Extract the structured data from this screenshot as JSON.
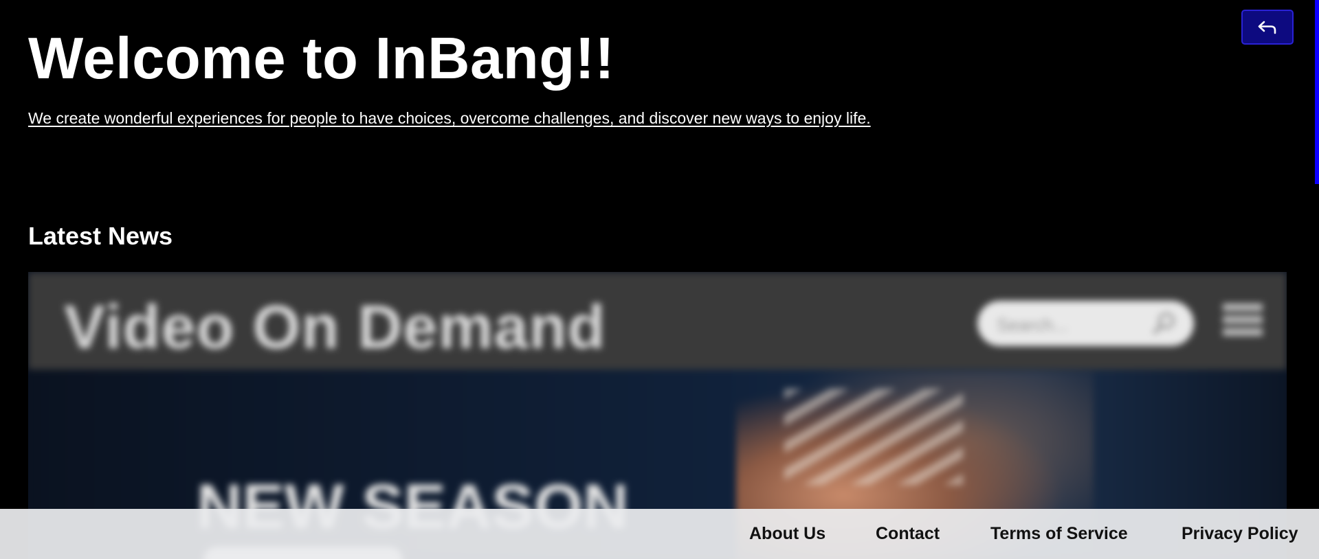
{
  "hero": {
    "title": "Welcome to InBang!!",
    "tagline": "We create wonderful experiences for people to have choices, overcome challenges, and discover new ways to enjoy life."
  },
  "back_button": {
    "icon": "back-arrow-icon"
  },
  "news": {
    "section_title": "Latest News",
    "card_image": {
      "header_title": "Video On Demand",
      "search_placeholder": "Search...",
      "banner_text": "NEW SEASON"
    }
  },
  "footer": {
    "links": [
      "About Us",
      "Contact",
      "Terms of Service",
      "Privacy Policy"
    ]
  },
  "colors": {
    "background": "#000000",
    "accent_button": "#0d0a80",
    "scroll_indicator": "#0c00ff",
    "footer_bg": "#ebecee"
  }
}
